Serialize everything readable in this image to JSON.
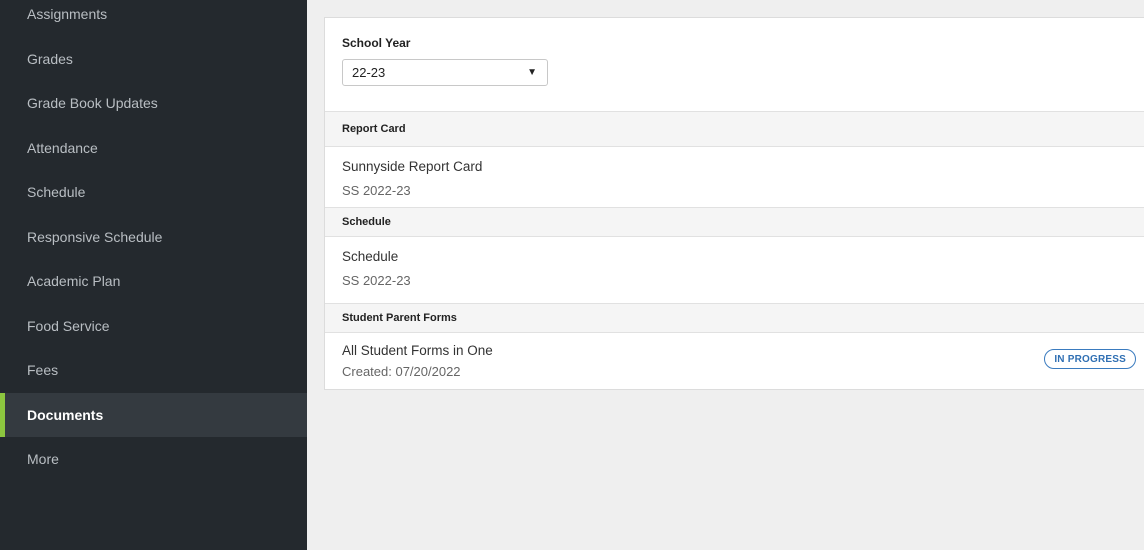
{
  "sidebar": {
    "items": [
      {
        "label": "Assignments"
      },
      {
        "label": "Grades"
      },
      {
        "label": "Grade Book Updates"
      },
      {
        "label": "Attendance"
      },
      {
        "label": "Schedule"
      },
      {
        "label": "Responsive Schedule"
      },
      {
        "label": "Academic Plan"
      },
      {
        "label": "Food Service"
      },
      {
        "label": "Fees"
      },
      {
        "label": "Documents",
        "active": true
      },
      {
        "label": "More"
      }
    ]
  },
  "school_year": {
    "label": "School Year",
    "selected": "22-23"
  },
  "sections": [
    {
      "header": "Report Card",
      "rows": [
        {
          "title": "Sunnyside Report Card",
          "subtitle": "SS 2022-23"
        }
      ]
    },
    {
      "header": "Schedule",
      "rows": [
        {
          "title": "Schedule",
          "subtitle": "SS 2022-23"
        }
      ]
    },
    {
      "header": "Student Parent Forms",
      "rows": [
        {
          "title": "All Student Forms in One",
          "subtitle": "Created: 07/20/2022",
          "status": "IN PROGRESS"
        }
      ]
    }
  ],
  "colors": {
    "sidebar_bg": "#24292e",
    "active_accent": "#8cc63f",
    "badge_blue": "#2f6fb3"
  }
}
